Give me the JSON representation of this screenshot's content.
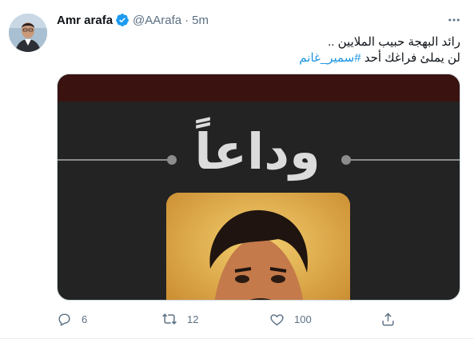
{
  "tweet": {
    "author": {
      "name": "Amr arafa",
      "handle": "@AArafa",
      "separator": "·",
      "time": "5m",
      "verified": true
    },
    "text": {
      "line1": "رائد البهجة حبيب الملايين ..",
      "line2_prefix": "لن يملئ فراغك أحد",
      "hashtag": "#سمير_غانم"
    },
    "media": {
      "headline": "وداعاً",
      "colors": {
        "top_band": "#3a1310",
        "background": "#232323",
        "photo_bg": "#e4b14f"
      }
    },
    "actions": {
      "reply_count": "6",
      "retweet_count": "12",
      "like_count": "100"
    },
    "icons": {
      "more": "more-icon",
      "reply": "reply-icon",
      "retweet": "retweet-icon",
      "like": "heart-icon",
      "share": "share-icon",
      "verified": "verified-badge-icon"
    },
    "colors": {
      "accent": "#1d9bf0",
      "muted": "#5b7083",
      "text": "#0f1419"
    }
  }
}
